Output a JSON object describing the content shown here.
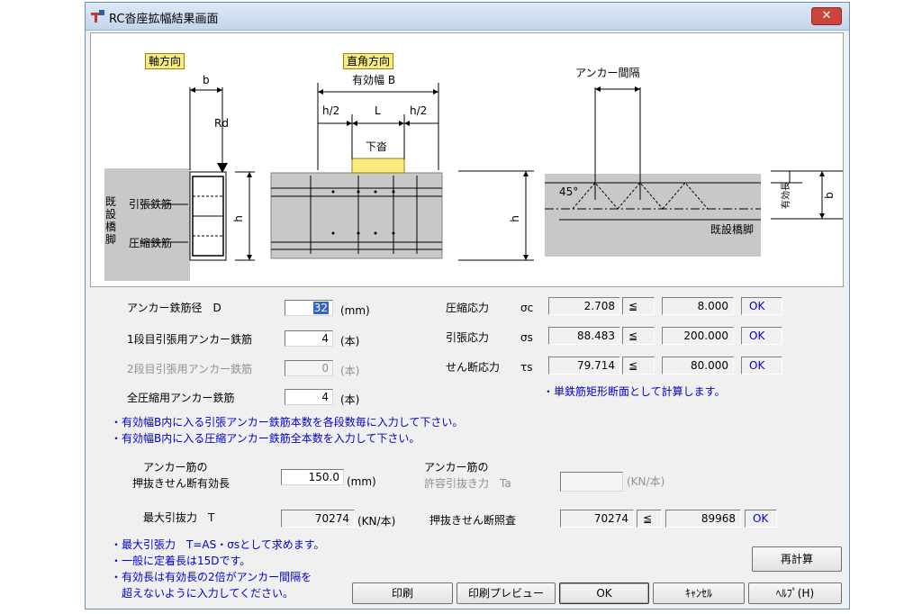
{
  "window": {
    "title": "RC沓座拡幅結果画面",
    "close_symbol": "✕"
  },
  "diagram": {
    "axial_label": "軸方向",
    "perp_label": "直角方向",
    "b": "b",
    "rd": "Rd",
    "h": "h",
    "existing_pier": "既設橋脚",
    "tension_bar": "引張鉄筋",
    "compression_bar": "圧縮鉄筋",
    "effective_width": "有効幅 B",
    "h2": "h/2",
    "L": "L",
    "shoe": "下沓",
    "anchor_spacing": "アンカー間隔",
    "angle": "45°",
    "effective_length": "有効長",
    "existing_pier_2": "既設橋脚"
  },
  "inputs": {
    "anchor_dia_label": "アンカー鉄筋径　D",
    "anchor_dia_value": "32",
    "unit_mm": "(mm)",
    "tier1_label": "1段目引張用アンカー鉄筋",
    "tier1_value": "4",
    "tier2_label": "2段目引張用アンカー鉄筋",
    "tier2_value": "0",
    "unit_hon": "(本)",
    "comp_label": "全圧縮用アンカー鉄筋",
    "comp_value": "4"
  },
  "stress": {
    "rows": [
      {
        "label": "圧縮応力",
        "sym": "σc",
        "value": "2.708",
        "op": "≦",
        "limit": "8.000",
        "judge": "OK"
      },
      {
        "label": "引張応力",
        "sym": "σs",
        "value": "88.483",
        "op": "≦",
        "limit": "200.000",
        "judge": "OK"
      },
      {
        "label": "せん断応力",
        "sym": "τs",
        "value": "79.714",
        "op": "≦",
        "limit": "80.000",
        "judge": "OK"
      }
    ],
    "note": "・単鉄筋矩形断面として計算します。"
  },
  "notes1": [
    "・有効幅B内に入る引張アンカー鉄筋本数を各段数毎に入力して下さい。",
    "・有効幅B内に入る圧縮アンカー鉄筋全本数を入力して下さい。"
  ],
  "anchor": {
    "len_label1": "アンカー筋の",
    "len_label2": "押抜きせん断有効長",
    "len_value": "150.0",
    "len_unit": "(mm)",
    "ta_label1": "アンカー筋の",
    "ta_label2": "許容引抜き力　Ta",
    "ta_value": "",
    "ta_unit": "(KN/本)",
    "t_label": "最大引抜力　T",
    "t_value": "70274",
    "t_unit": "(KN/本)",
    "punch_label": "押抜きせん断照査",
    "punch_value": "70274",
    "punch_op": "≦",
    "punch_limit": "89968",
    "punch_judge": "OK"
  },
  "notes2": [
    "・最大引張力　T=AS・σsとして求めます。",
    "・一般に定着長は15Dです。",
    "・有効長は有効長の2倍がアンカー間隔を",
    "　超えないように入力してください。"
  ],
  "buttons": {
    "recalc": "再計算",
    "print": "印刷",
    "preview": "印刷プレビュー",
    "ok": "OK",
    "cancel": "ｷｬﾝｾﾙ",
    "help": "ﾍﾙﾌﾟ(H)"
  }
}
